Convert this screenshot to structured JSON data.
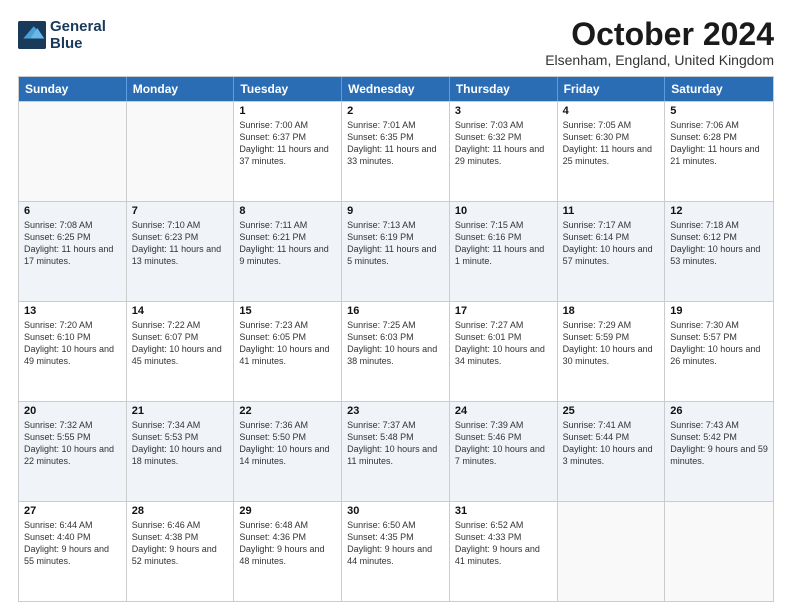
{
  "header": {
    "logo_line1": "General",
    "logo_line2": "Blue",
    "month_title": "October 2024",
    "location": "Elsenham, England, United Kingdom"
  },
  "weekdays": [
    "Sunday",
    "Monday",
    "Tuesday",
    "Wednesday",
    "Thursday",
    "Friday",
    "Saturday"
  ],
  "rows": [
    [
      {
        "day": "",
        "sunrise": "",
        "sunset": "",
        "daylight": ""
      },
      {
        "day": "",
        "sunrise": "",
        "sunset": "",
        "daylight": ""
      },
      {
        "day": "1",
        "sunrise": "Sunrise: 7:00 AM",
        "sunset": "Sunset: 6:37 PM",
        "daylight": "Daylight: 11 hours and 37 minutes."
      },
      {
        "day": "2",
        "sunrise": "Sunrise: 7:01 AM",
        "sunset": "Sunset: 6:35 PM",
        "daylight": "Daylight: 11 hours and 33 minutes."
      },
      {
        "day": "3",
        "sunrise": "Sunrise: 7:03 AM",
        "sunset": "Sunset: 6:32 PM",
        "daylight": "Daylight: 11 hours and 29 minutes."
      },
      {
        "day": "4",
        "sunrise": "Sunrise: 7:05 AM",
        "sunset": "Sunset: 6:30 PM",
        "daylight": "Daylight: 11 hours and 25 minutes."
      },
      {
        "day": "5",
        "sunrise": "Sunrise: 7:06 AM",
        "sunset": "Sunset: 6:28 PM",
        "daylight": "Daylight: 11 hours and 21 minutes."
      }
    ],
    [
      {
        "day": "6",
        "sunrise": "Sunrise: 7:08 AM",
        "sunset": "Sunset: 6:25 PM",
        "daylight": "Daylight: 11 hours and 17 minutes."
      },
      {
        "day": "7",
        "sunrise": "Sunrise: 7:10 AM",
        "sunset": "Sunset: 6:23 PM",
        "daylight": "Daylight: 11 hours and 13 minutes."
      },
      {
        "day": "8",
        "sunrise": "Sunrise: 7:11 AM",
        "sunset": "Sunset: 6:21 PM",
        "daylight": "Daylight: 11 hours and 9 minutes."
      },
      {
        "day": "9",
        "sunrise": "Sunrise: 7:13 AM",
        "sunset": "Sunset: 6:19 PM",
        "daylight": "Daylight: 11 hours and 5 minutes."
      },
      {
        "day": "10",
        "sunrise": "Sunrise: 7:15 AM",
        "sunset": "Sunset: 6:16 PM",
        "daylight": "Daylight: 11 hours and 1 minute."
      },
      {
        "day": "11",
        "sunrise": "Sunrise: 7:17 AM",
        "sunset": "Sunset: 6:14 PM",
        "daylight": "Daylight: 10 hours and 57 minutes."
      },
      {
        "day": "12",
        "sunrise": "Sunrise: 7:18 AM",
        "sunset": "Sunset: 6:12 PM",
        "daylight": "Daylight: 10 hours and 53 minutes."
      }
    ],
    [
      {
        "day": "13",
        "sunrise": "Sunrise: 7:20 AM",
        "sunset": "Sunset: 6:10 PM",
        "daylight": "Daylight: 10 hours and 49 minutes."
      },
      {
        "day": "14",
        "sunrise": "Sunrise: 7:22 AM",
        "sunset": "Sunset: 6:07 PM",
        "daylight": "Daylight: 10 hours and 45 minutes."
      },
      {
        "day": "15",
        "sunrise": "Sunrise: 7:23 AM",
        "sunset": "Sunset: 6:05 PM",
        "daylight": "Daylight: 10 hours and 41 minutes."
      },
      {
        "day": "16",
        "sunrise": "Sunrise: 7:25 AM",
        "sunset": "Sunset: 6:03 PM",
        "daylight": "Daylight: 10 hours and 38 minutes."
      },
      {
        "day": "17",
        "sunrise": "Sunrise: 7:27 AM",
        "sunset": "Sunset: 6:01 PM",
        "daylight": "Daylight: 10 hours and 34 minutes."
      },
      {
        "day": "18",
        "sunrise": "Sunrise: 7:29 AM",
        "sunset": "Sunset: 5:59 PM",
        "daylight": "Daylight: 10 hours and 30 minutes."
      },
      {
        "day": "19",
        "sunrise": "Sunrise: 7:30 AM",
        "sunset": "Sunset: 5:57 PM",
        "daylight": "Daylight: 10 hours and 26 minutes."
      }
    ],
    [
      {
        "day": "20",
        "sunrise": "Sunrise: 7:32 AM",
        "sunset": "Sunset: 5:55 PM",
        "daylight": "Daylight: 10 hours and 22 minutes."
      },
      {
        "day": "21",
        "sunrise": "Sunrise: 7:34 AM",
        "sunset": "Sunset: 5:53 PM",
        "daylight": "Daylight: 10 hours and 18 minutes."
      },
      {
        "day": "22",
        "sunrise": "Sunrise: 7:36 AM",
        "sunset": "Sunset: 5:50 PM",
        "daylight": "Daylight: 10 hours and 14 minutes."
      },
      {
        "day": "23",
        "sunrise": "Sunrise: 7:37 AM",
        "sunset": "Sunset: 5:48 PM",
        "daylight": "Daylight: 10 hours and 11 minutes."
      },
      {
        "day": "24",
        "sunrise": "Sunrise: 7:39 AM",
        "sunset": "Sunset: 5:46 PM",
        "daylight": "Daylight: 10 hours and 7 minutes."
      },
      {
        "day": "25",
        "sunrise": "Sunrise: 7:41 AM",
        "sunset": "Sunset: 5:44 PM",
        "daylight": "Daylight: 10 hours and 3 minutes."
      },
      {
        "day": "26",
        "sunrise": "Sunrise: 7:43 AM",
        "sunset": "Sunset: 5:42 PM",
        "daylight": "Daylight: 9 hours and 59 minutes."
      }
    ],
    [
      {
        "day": "27",
        "sunrise": "Sunrise: 6:44 AM",
        "sunset": "Sunset: 4:40 PM",
        "daylight": "Daylight: 9 hours and 55 minutes."
      },
      {
        "day": "28",
        "sunrise": "Sunrise: 6:46 AM",
        "sunset": "Sunset: 4:38 PM",
        "daylight": "Daylight: 9 hours and 52 minutes."
      },
      {
        "day": "29",
        "sunrise": "Sunrise: 6:48 AM",
        "sunset": "Sunset: 4:36 PM",
        "daylight": "Daylight: 9 hours and 48 minutes."
      },
      {
        "day": "30",
        "sunrise": "Sunrise: 6:50 AM",
        "sunset": "Sunset: 4:35 PM",
        "daylight": "Daylight: 9 hours and 44 minutes."
      },
      {
        "day": "31",
        "sunrise": "Sunrise: 6:52 AM",
        "sunset": "Sunset: 4:33 PM",
        "daylight": "Daylight: 9 hours and 41 minutes."
      },
      {
        "day": "",
        "sunrise": "",
        "sunset": "",
        "daylight": ""
      },
      {
        "day": "",
        "sunrise": "",
        "sunset": "",
        "daylight": ""
      }
    ]
  ]
}
